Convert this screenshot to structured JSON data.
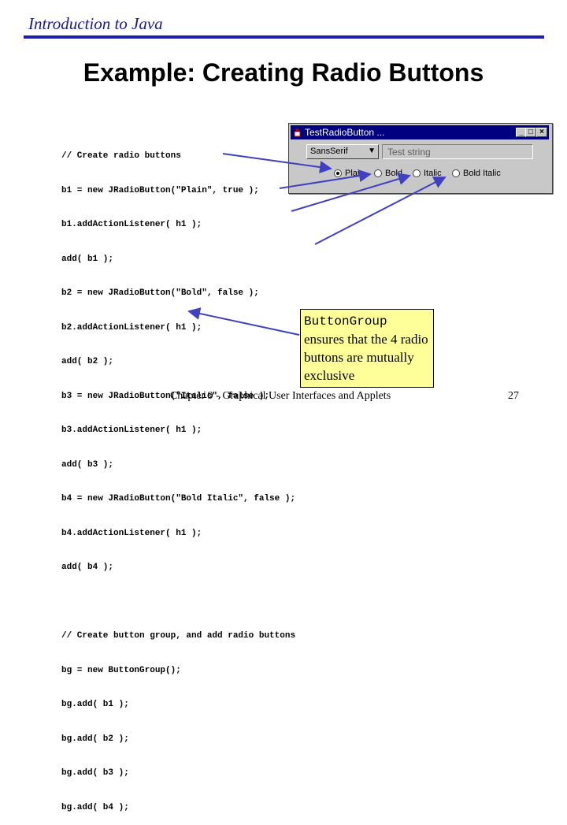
{
  "header": {
    "title": "Introduction to Java",
    "rule_color": "#2020b0"
  },
  "slide": {
    "title": "Example: Creating Radio Buttons"
  },
  "code": {
    "lines": [
      "// Create radio buttons",
      "b1 = new JRadioButton(\"Plain\", true );",
      "b1.addActionListener( h1 );",
      "add( b1 );",
      "b2 = new JRadioButton(\"Bold\", false );",
      "b2.addActionListener( h1 );",
      "add( b2 );",
      "b3 = new JRadioButton(\"Italic\", false );",
      "b3.addActionListener( h1 );",
      "add( b3 );",
      "b4 = new JRadioButton(\"Bold Italic\", false );",
      "b4.addActionListener( h1 );",
      "add( b4 );",
      "",
      "// Create button group, and add radio buttons",
      "bg = new ButtonGroup();",
      "bg.add( b1 );",
      "bg.add( b2 );",
      "bg.add( b3 );",
      "bg.add( b4 );"
    ]
  },
  "window": {
    "title": "TestRadioButton ...",
    "controls": {
      "minimize": "_",
      "maximize": "□",
      "close": "×"
    },
    "font_combo": {
      "value": "SansSerif",
      "arrow_icon": "chevron-down-icon"
    },
    "text_field": {
      "value": "Test string"
    },
    "radios": [
      {
        "label": "Plain",
        "selected": true
      },
      {
        "label": "Bold",
        "selected": false
      },
      {
        "label": "Italic",
        "selected": false
      },
      {
        "label": "Bold Italic",
        "selected": false
      }
    ]
  },
  "callout": {
    "code_text": "ButtonGroup",
    "text": "ensures that the 4 radio buttons are mutually exclusive"
  },
  "footer": {
    "text": "Chapter 9 - Graphical User Interfaces and Applets",
    "page": "27"
  },
  "colors": {
    "title_bar": "#000080",
    "arrow": "#4040c0",
    "callout_bg": "#ffff9a"
  }
}
